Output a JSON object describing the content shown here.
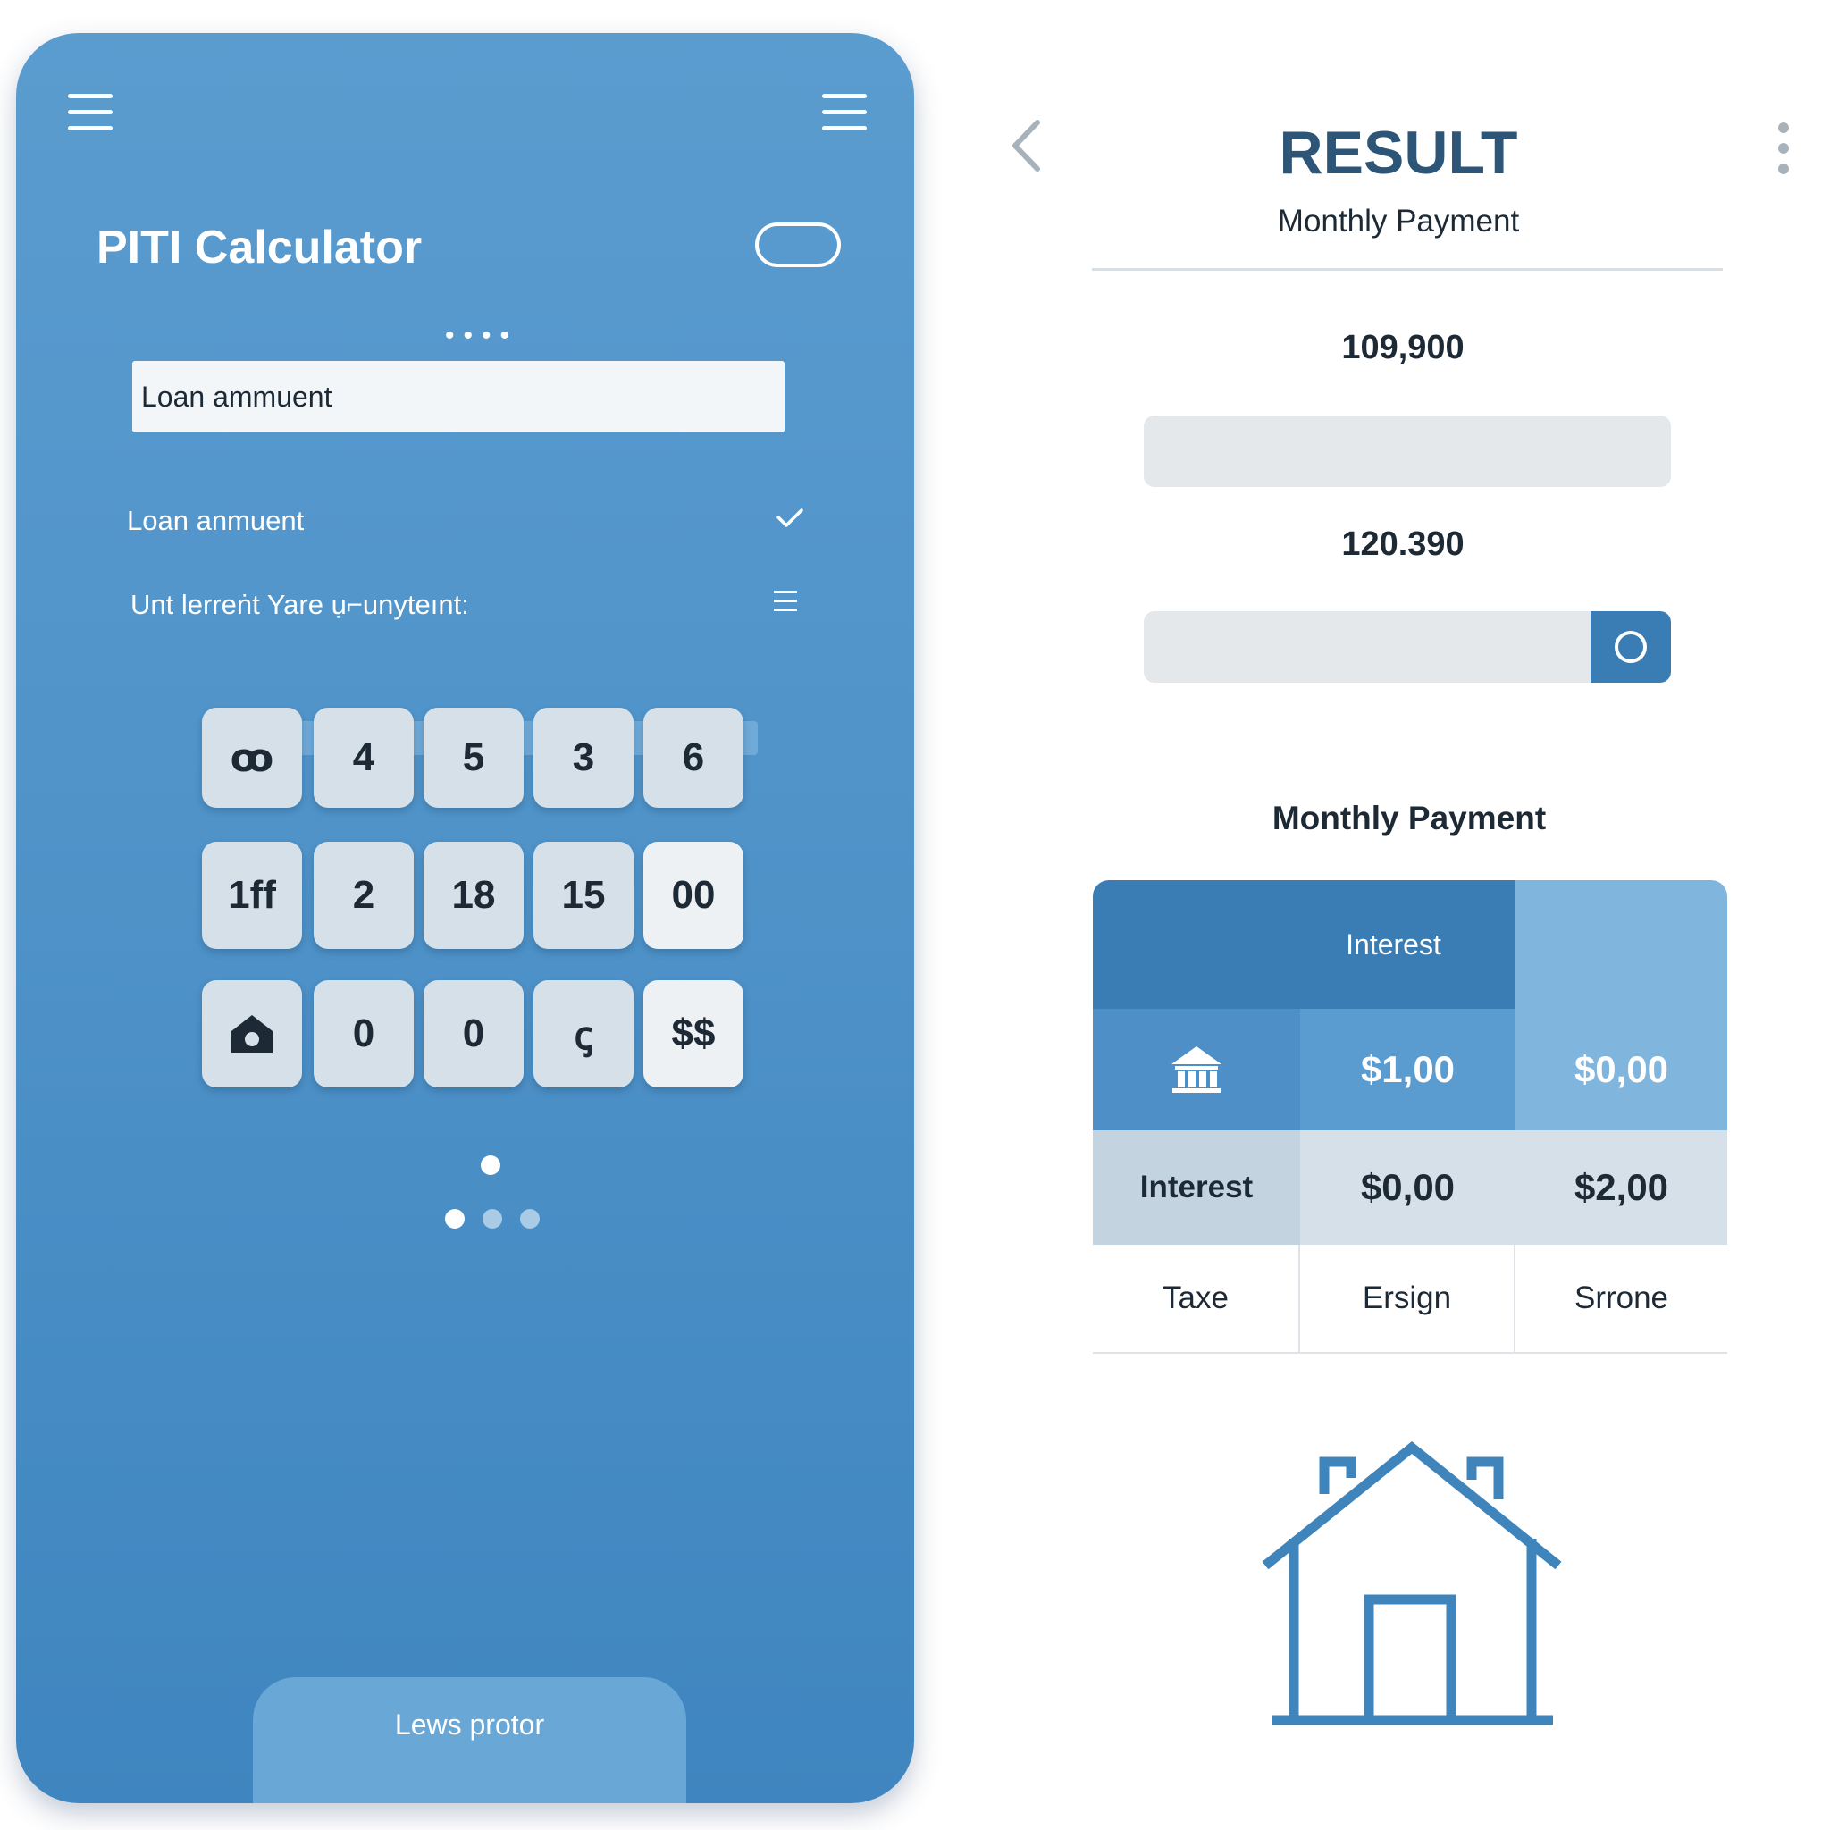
{
  "app": {
    "title": "PITI Calculator"
  },
  "form": {
    "loan_input_value": "Loan ammuent",
    "loan_select_label": "Loan anmuent",
    "interest_label": "Unt lerreṅt  Yare ụ⌐unyteınt:"
  },
  "keypad": {
    "keys": [
      {
        "label": "ꝏ",
        "style": "normal"
      },
      {
        "label": "4",
        "style": "normal"
      },
      {
        "label": "5",
        "style": "normal"
      },
      {
        "label": "3",
        "style": "normal"
      },
      {
        "label": "6",
        "style": "normal"
      },
      {
        "label": "1ff",
        "style": "normal"
      },
      {
        "label": "2",
        "style": "normal"
      },
      {
        "label": "18",
        "style": "normal"
      },
      {
        "label": "15",
        "style": "normal"
      },
      {
        "label": "00",
        "style": "light"
      },
      {
        "label": "",
        "style": "normal",
        "icon": "home-camera-icon"
      },
      {
        "label": "0",
        "style": "normal"
      },
      {
        "label": "0",
        "style": "normal"
      },
      {
        "label": "ꞔ",
        "style": "normal"
      },
      {
        "label": "$$",
        "style": "light"
      }
    ]
  },
  "pagination": {
    "active_index": 0,
    "count": 3
  },
  "bottom_tab": {
    "label": "Lews protor"
  },
  "result": {
    "title": "RESULT",
    "subtitle": "Monthly Payment",
    "value1": "109,900",
    "value2": "120.390",
    "breakdown_heading": "Monthly Payment"
  },
  "table": {
    "header": "Interest",
    "row1": [
      "",
      "$1,00",
      "$0,00"
    ],
    "row2": [
      "Interest",
      "$0,00",
      "$2,00"
    ],
    "row3": [
      "Taxe",
      "Ersign",
      "Srrone"
    ]
  },
  "colors": {
    "primary": "#4f93c9",
    "dark_blue": "#3a7db4",
    "title_blue": "#2d5577",
    "text_dark": "#1d2a36"
  }
}
